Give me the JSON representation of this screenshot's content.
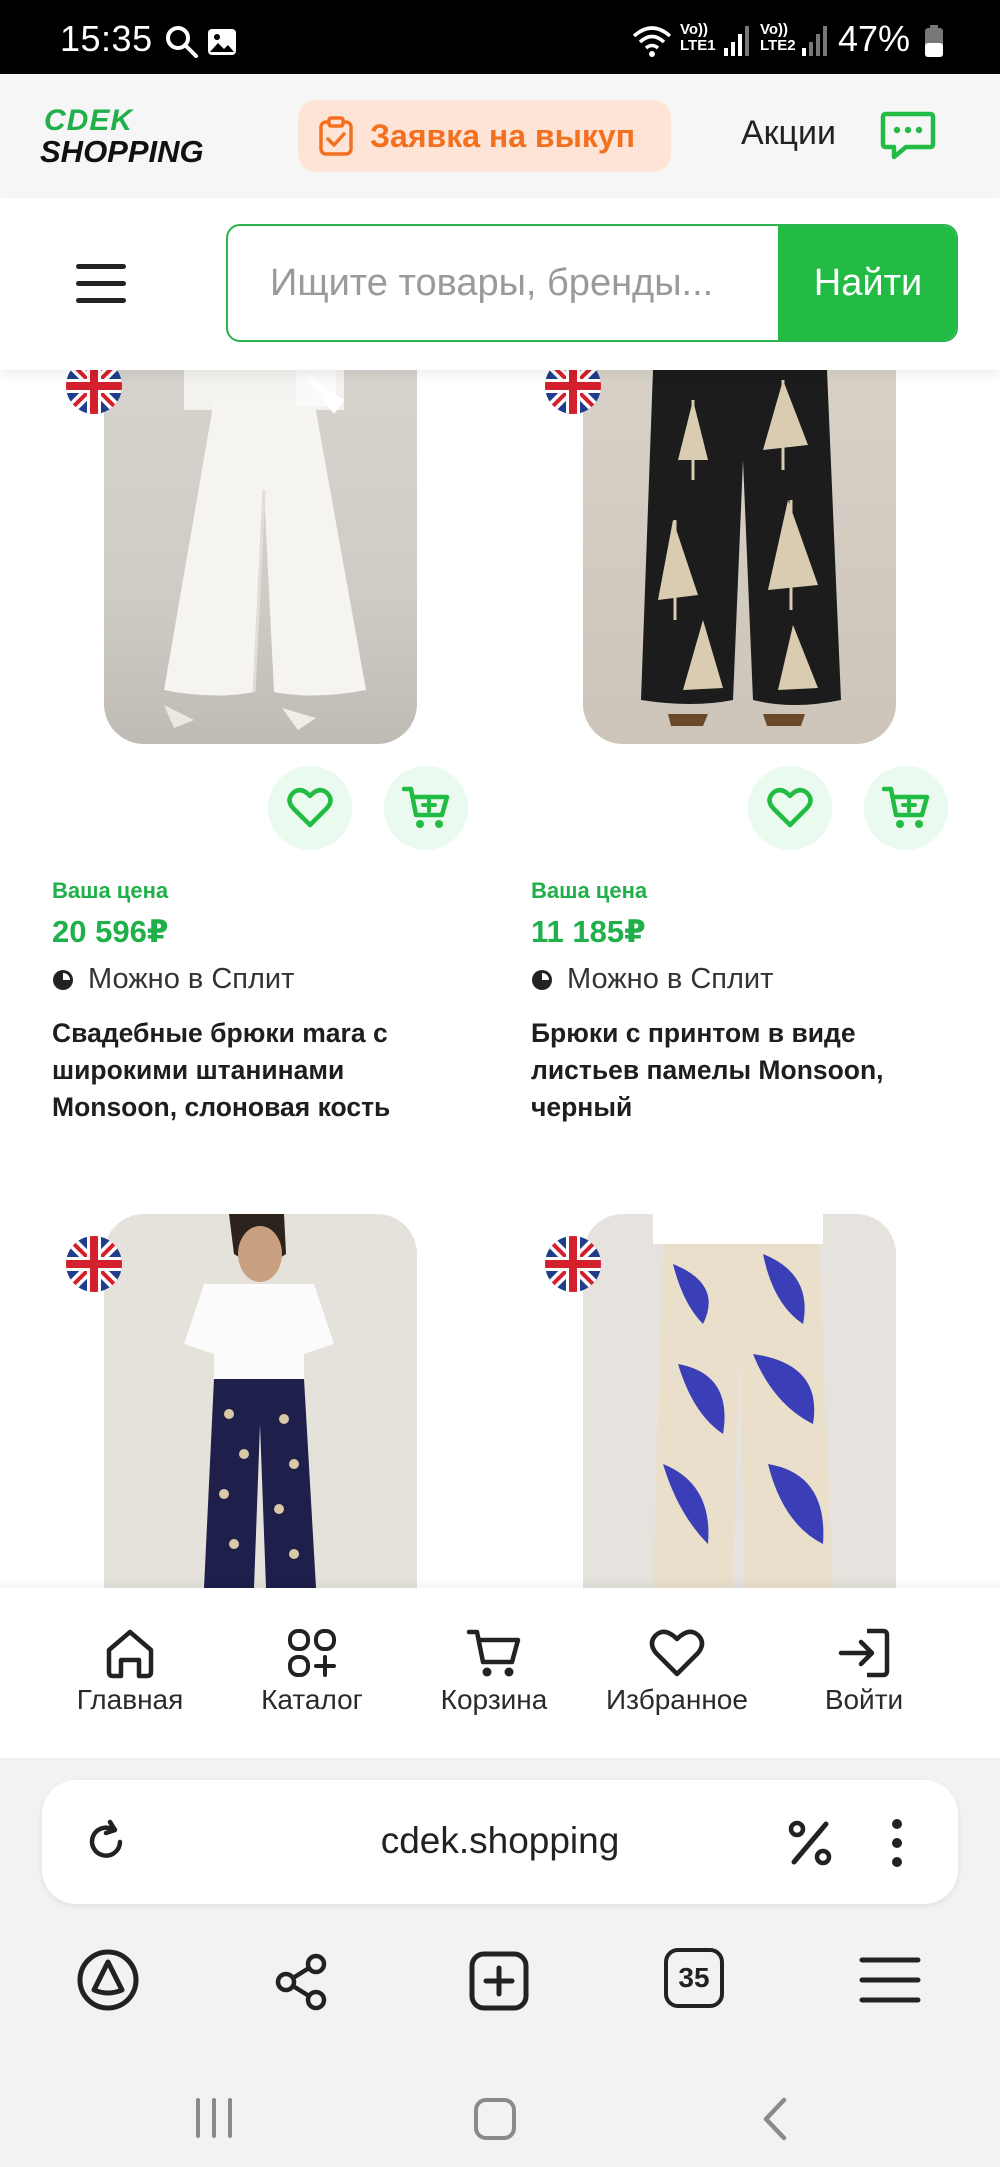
{
  "status_bar": {
    "time": "15:35",
    "lte1": "LTE1",
    "lte2": "LTE2",
    "vo1": "Vo))",
    "vo2": "Vo))",
    "battery": "47%"
  },
  "header": {
    "logo_top": "CDEK",
    "logo_bottom": "SHOPPING",
    "buyout_label": "Заявка на выкуп",
    "promo_label": "Акции"
  },
  "search": {
    "placeholder": "Ищите товары, бренды...",
    "button_label": "Найти"
  },
  "products": [
    {
      "price_caption": "Ваша цена",
      "price": "20 596₽",
      "split": "Можно в Сплит",
      "name": "Свадебные брюки mara с широкими штанинами Monsoon, слоновая кость"
    },
    {
      "price_caption": "Ваша цена",
      "price": "11 185₽",
      "split": "Можно в Сплит",
      "name": "Брюки с принтом в виде листьев памелы Monsoon, черный"
    }
  ],
  "bottom_nav": {
    "home": "Главная",
    "catalog": "Каталог",
    "cart": "Корзина",
    "favorites": "Избранное",
    "login": "Войти"
  },
  "browser": {
    "url": "cdek.shopping",
    "tab_count": "35"
  },
  "colors": {
    "brand_green": "#22bc45",
    "accent_orange": "#f37021"
  }
}
